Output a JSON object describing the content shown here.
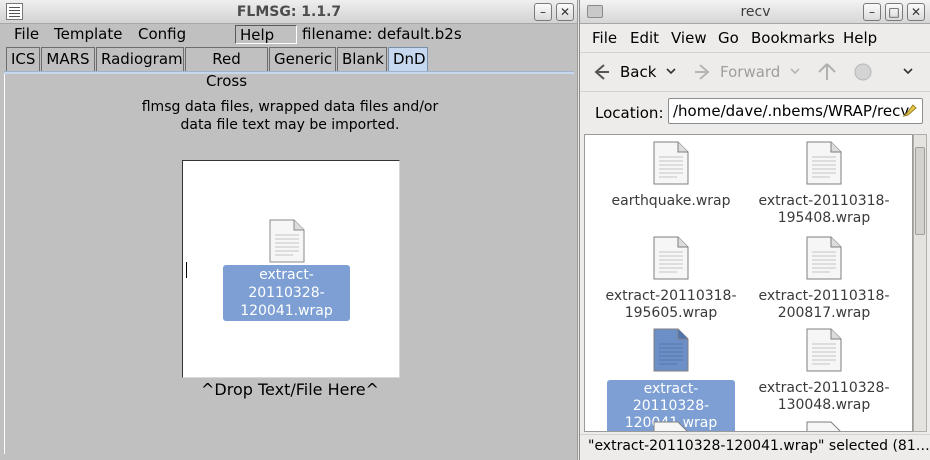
{
  "flmsg": {
    "title": "FLMSG: 1.1.7",
    "menu": {
      "file": "File",
      "template": "Template",
      "config": "Config",
      "help": "Help"
    },
    "filename": "filename: default.b2s",
    "tabs": [
      "ICS",
      "MARS",
      "Radiogram",
      "Red Cross",
      "Generic",
      "Blank",
      "DnD"
    ],
    "active_tab": "DnD",
    "description_line1": "flmsg data files, wrapped data files and/or",
    "description_line2": "data file text may be imported.",
    "dropped_file_line1": "extract-20110328-",
    "dropped_file_line2": "120041.wrap",
    "drop_caption": "^Drop Text/File Here^",
    "window_buttons": {
      "minimize": "–",
      "close": "✕"
    }
  },
  "recv": {
    "title": "recv",
    "menu": {
      "file": "File",
      "edit": "Edit",
      "view": "View",
      "go": "Go",
      "bookmarks": "Bookmarks",
      "help": "Help"
    },
    "toolbar": {
      "back": "Back",
      "forward": "Forward"
    },
    "location_label": "Location:",
    "location_value": "/home/dave/.nbems/WRAP/recv",
    "files": [
      {
        "line1": "earthquake.wrap",
        "line2": "",
        "selected": false
      },
      {
        "line1": "extract-20110318-",
        "line2": "195408.wrap",
        "selected": false
      },
      {
        "line1": "extract-20110318-",
        "line2": "195605.wrap",
        "selected": false
      },
      {
        "line1": "extract-20110318-",
        "line2": "200817.wrap",
        "selected": false
      },
      {
        "line1": "extract-20110328-",
        "line2": "120041.wrap",
        "selected": true
      },
      {
        "line1": "extract-20110328-",
        "line2": "130048.wrap",
        "selected": false
      }
    ],
    "status": "\"extract-20110328-120041.wrap\" selected (81…",
    "window_buttons": {
      "minimize": "–",
      "maximize": "□",
      "close": "✕"
    }
  },
  "colors": {
    "selection": "#7d9fd4",
    "active_tab": "#c6d8ef",
    "flmsg_bg": "#c0c0c0",
    "nautilus_bg": "#edeceb"
  },
  "icons": [
    "document-icon",
    "folder-icon",
    "back-arrow-icon",
    "forward-arrow-icon",
    "up-arrow-icon",
    "stop-icon",
    "edit-location-icon"
  ]
}
